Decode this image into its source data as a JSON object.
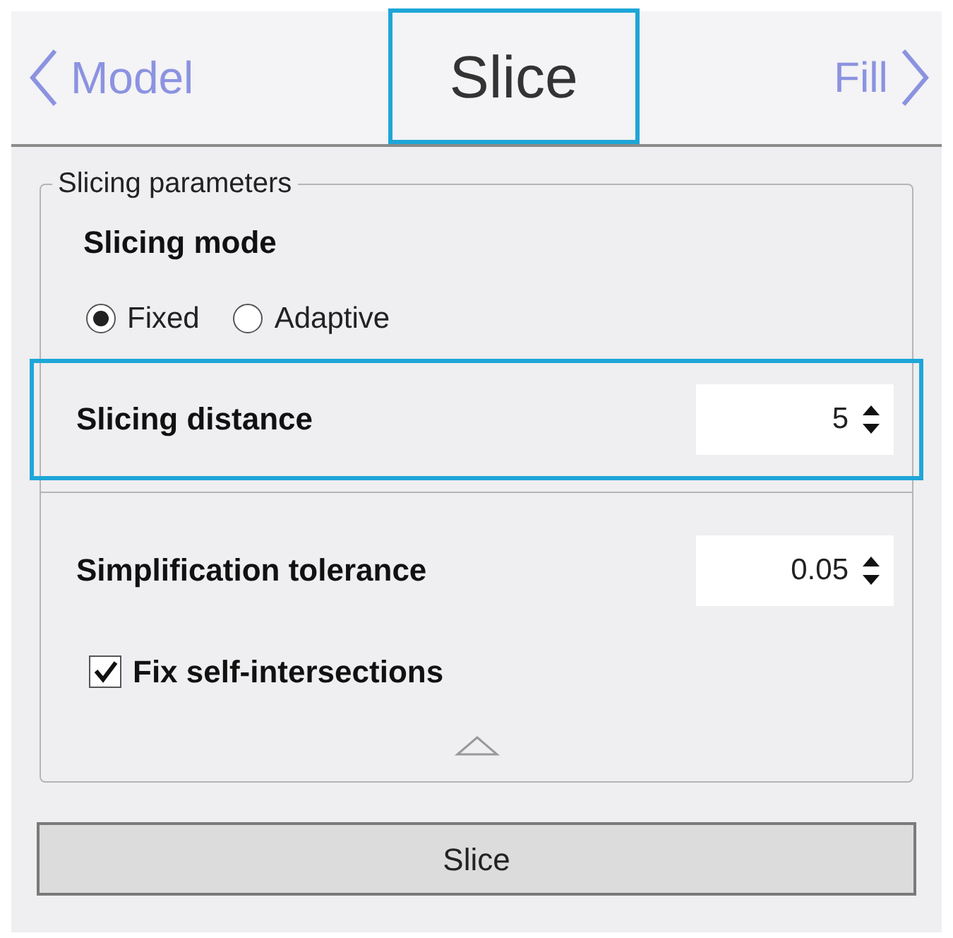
{
  "nav": {
    "back": {
      "label": "Model"
    },
    "title": {
      "label": "Slice",
      "highlighted": true
    },
    "forward": {
      "label": "Fill"
    }
  },
  "group": {
    "legend": "Slicing parameters",
    "mode_label": "Slicing mode",
    "modes": [
      {
        "label": "Fixed",
        "selected": true
      },
      {
        "label": "Adaptive",
        "selected": false
      }
    ],
    "fields": [
      {
        "label": "Slicing distance",
        "value": "5",
        "highlighted": true
      },
      {
        "label": "Simplification tolerance",
        "value": "0.05",
        "highlighted": false
      }
    ],
    "fix": {
      "label": "Fix self-intersections",
      "checked": true
    }
  },
  "button": {
    "label": "Slice"
  }
}
